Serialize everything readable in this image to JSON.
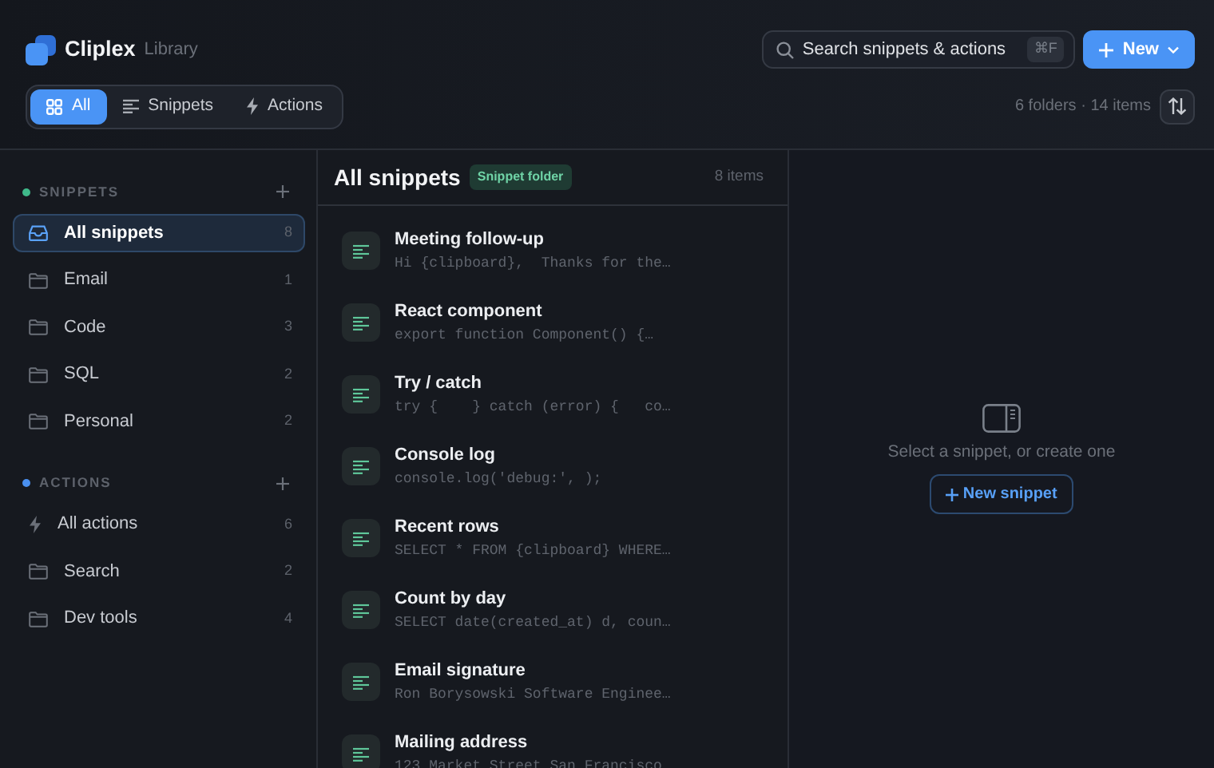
{
  "app": {
    "name": "Cliplex",
    "subtitle": "Library"
  },
  "search": {
    "placeholder": "Search snippets & actions",
    "shortcut": "⌘F"
  },
  "new_button": {
    "label": "New"
  },
  "filter_tabs": [
    {
      "label": "All",
      "kind": "grid",
      "selected": true
    },
    {
      "label": "Snippets",
      "kind": "lines",
      "selected": false
    },
    {
      "label": "Actions",
      "kind": "bolt",
      "selected": false
    }
  ],
  "summary": "6 folders · 14 items",
  "sidebar": {
    "sections": [
      {
        "title": "SNIPPETS",
        "color": "#3fb98a",
        "items": [
          {
            "label": "All snippets",
            "count": "8",
            "kind": "inbox",
            "selected": true
          },
          {
            "label": "Email",
            "count": "1",
            "kind": "folder",
            "selected": false
          },
          {
            "label": "Code",
            "count": "3",
            "kind": "folder",
            "selected": false
          },
          {
            "label": "SQL",
            "count": "2",
            "kind": "folder",
            "selected": false
          },
          {
            "label": "Personal",
            "count": "2",
            "kind": "folder",
            "selected": false
          }
        ]
      },
      {
        "title": "ACTIONS",
        "color": "#4a90f0",
        "items": [
          {
            "label": "All actions",
            "count": "6",
            "kind": "bolt",
            "selected": false
          },
          {
            "label": "Search",
            "count": "2",
            "kind": "folder",
            "selected": false
          },
          {
            "label": "Dev tools",
            "count": "4",
            "kind": "folder",
            "selected": false
          }
        ]
      }
    ]
  },
  "list": {
    "title": "All snippets",
    "badge": "Snippet folder",
    "count": "8 items",
    "items": [
      {
        "title": "Meeting follow-up",
        "preview": "Hi {clipboard},  Thanks for the…"
      },
      {
        "title": "React component",
        "preview": "export function Component() {…"
      },
      {
        "title": "Try / catch",
        "preview": "try {    } catch (error) {   co…"
      },
      {
        "title": "Console log",
        "preview": "console.log('debug:', );"
      },
      {
        "title": "Recent rows",
        "preview": "SELECT * FROM {clipboard} WHERE…"
      },
      {
        "title": "Count by day",
        "preview": "SELECT date(created_at) d, coun…"
      },
      {
        "title": "Email signature",
        "preview": "Ron Borysowski Software Enginee…"
      },
      {
        "title": "Mailing address",
        "preview": "123 Market Street San Francisco"
      }
    ]
  },
  "detail": {
    "message": "Select a snippet, or create one",
    "button": "New snippet"
  }
}
